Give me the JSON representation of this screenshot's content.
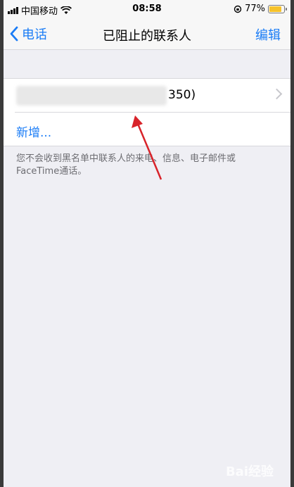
{
  "status_bar": {
    "carrier": "中国移动",
    "time": "08:58",
    "battery_percent": "77%"
  },
  "nav": {
    "back_label": "电话",
    "title": "已阻止的联系人",
    "edit_label": "编辑"
  },
  "list": {
    "contact_visible_suffix": "350)",
    "add_label": "新增..."
  },
  "footer_text": "您不会收到黑名单中联系人的来电、信息、电子邮件或FaceTime通话。",
  "watermark": "Bai经验",
  "colors": {
    "accent": "#1a7cf6",
    "background": "#efeff4",
    "annotation_arrow": "#d8232a"
  }
}
